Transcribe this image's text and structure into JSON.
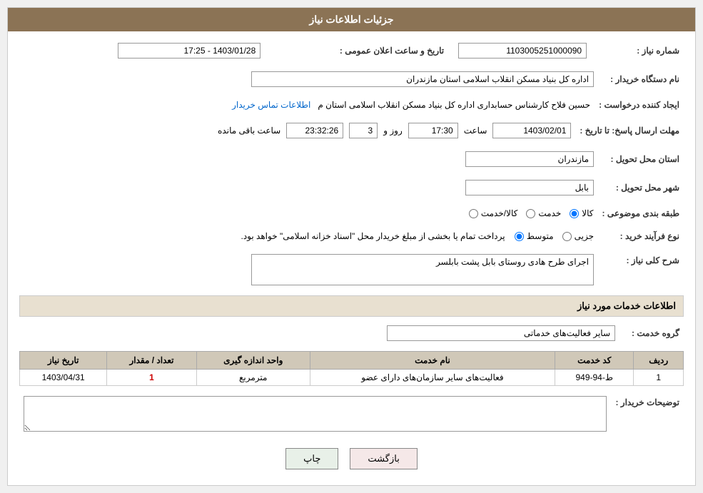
{
  "header": {
    "title": "جزئیات اطلاعات نیاز"
  },
  "fields": {
    "shomareNiaz_label": "شماره نیاز :",
    "shomareNiaz_value": "1103005251000090",
    "namDastgah_label": "نام دستگاه خریدار :",
    "namDastgah_value": "اداره کل بنیاد مسکن انقلاب اسلامی استان مازندران",
    "tarikh_label": "تاریخ و ساعت اعلان عمومی :",
    "tarikh_value": "1403/01/28 - 17:25",
    "ijadKonande_label": "ایجاد کننده درخواست :",
    "ijadKonande_value": "حسین فلاح کارشناس حسابداری اداره کل بنیاد مسکن انقلاب اسلامی استان م",
    "ijadKonande_link": "اطلاعات تماس خریدار",
    "mohlatErsal_label": "مهلت ارسال پاسخ: تا تاریخ :",
    "date_value": "1403/02/01",
    "saat_label": "ساعت",
    "saat_value": "17:30",
    "rooz_label": "روز و",
    "rooz_value": "3",
    "countdown_value": "23:32:26",
    "countdown_suffix": "ساعت باقی مانده",
    "ostan_label": "استان محل تحویل :",
    "ostan_value": "مازندران",
    "shahr_label": "شهر محل تحویل :",
    "shahr_value": "بابل",
    "tabaqe_label": "طبقه بندی موضوعی :",
    "tabaqe_options": [
      "کالا",
      "خدمت",
      "کالا/خدمت"
    ],
    "tabaqe_selected": "کالا",
    "noefarayand_label": "نوع فرآیند خرید :",
    "noefarayand_options": [
      "جزیی",
      "متوسط"
    ],
    "noefarayand_selected": "متوسط",
    "noefarayand_note": "پرداخت تمام یا بخشی از مبلغ خریدار محل \"اسناد خزانه اسلامی\" خواهد بود.",
    "sharh_label": "شرح کلی نیاز :",
    "sharh_value": "اجرای طرح هادی روستای بابل پشت بابلسر",
    "services_header": "اطلاعات خدمات مورد نیاز",
    "groheKhedmat_label": "گروه خدمت :",
    "groheKhedmat_value": "سایر فعالیت‌های خدماتی",
    "table": {
      "headers": [
        "ردیف",
        "کد خدمت",
        "نام خدمت",
        "واحد اندازه گیری",
        "تعداد / مقدار",
        "تاریخ نیاز"
      ],
      "rows": [
        {
          "radif": "1",
          "kodKhedmat": "ط-94-949",
          "namKhedmat": "فعالیت‌های سایر سازمان‌های دارای عضو",
          "vahed": "مترمربع",
          "tedad": "1",
          "tarikh": "1403/04/31"
        }
      ]
    },
    "tozihat_label": "توضیحات خریدار :",
    "tozihat_value": ""
  },
  "buttons": {
    "print": "چاپ",
    "back": "بازگشت"
  }
}
